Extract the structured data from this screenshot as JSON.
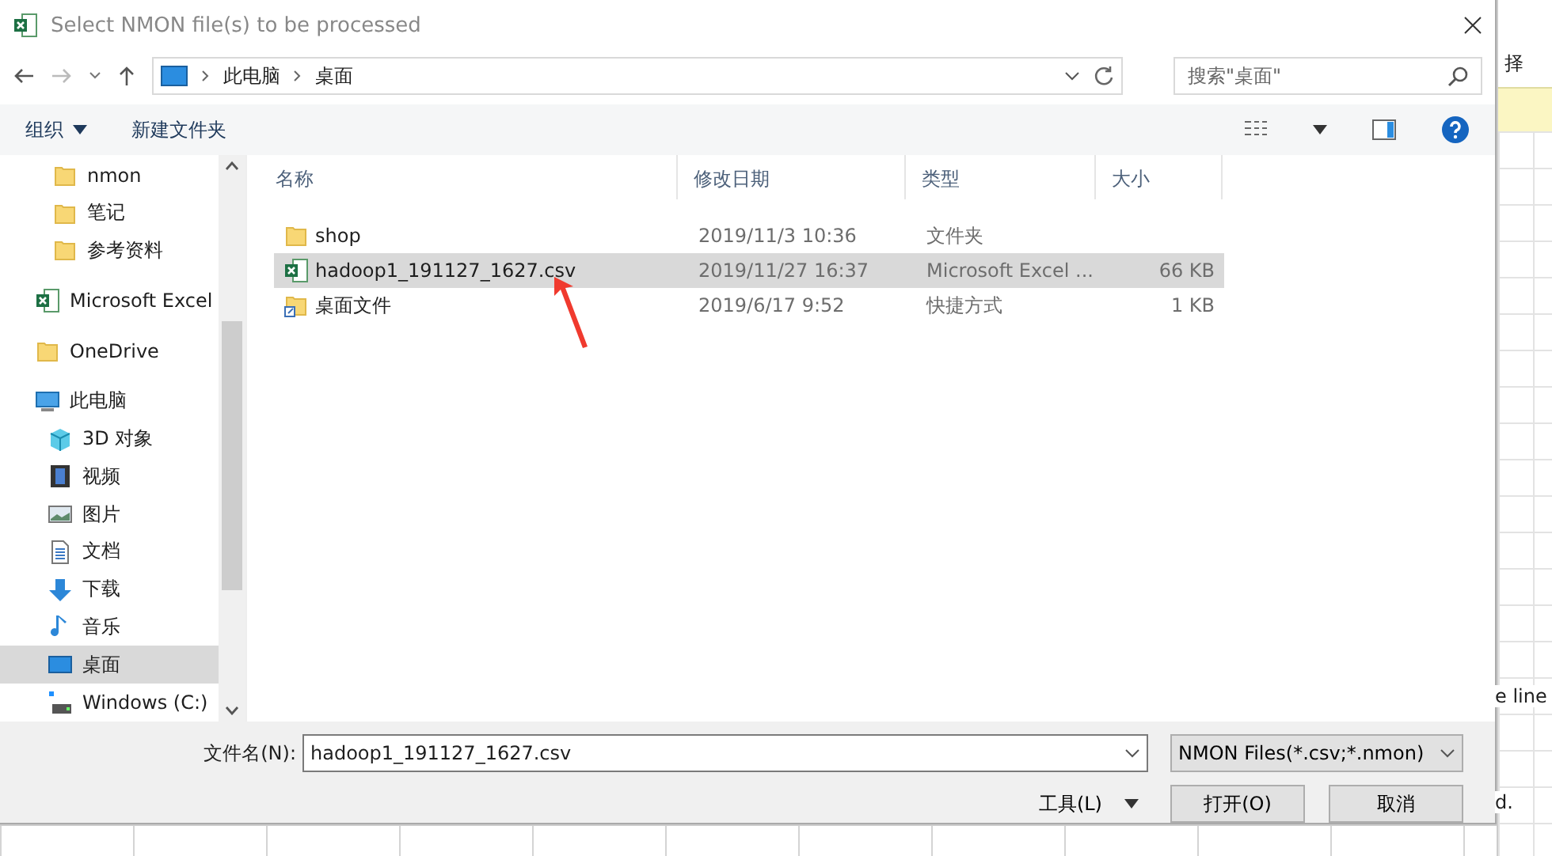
{
  "window": {
    "title": "Select NMON file(s) to be processed"
  },
  "address": {
    "path": [
      "此电脑",
      "桌面"
    ],
    "search_placeholder": "搜索\"桌面\""
  },
  "toolbar": {
    "organize": "组织",
    "new_folder": "新建文件夹"
  },
  "sidebar": {
    "items": [
      {
        "label": "nmon",
        "kind": "folder",
        "indented": true,
        "selected": false
      },
      {
        "label": "笔记",
        "kind": "folder",
        "indented": true,
        "selected": false
      },
      {
        "label": "参考资料",
        "kind": "folder",
        "indented": true,
        "selected": false
      },
      {
        "label": "Microsoft Excel",
        "kind": "excel",
        "indented": false,
        "selected": false
      },
      {
        "label": "OneDrive",
        "kind": "folder",
        "indented": false,
        "selected": false
      },
      {
        "label": "此电脑",
        "kind": "pc",
        "indented": false,
        "selected": false,
        "children": [
          {
            "label": "3D 对象",
            "kind": "cube",
            "selected": false
          },
          {
            "label": "视频",
            "kind": "video",
            "selected": false
          },
          {
            "label": "图片",
            "kind": "image",
            "selected": false
          },
          {
            "label": "文档",
            "kind": "doc",
            "selected": false
          },
          {
            "label": "下载",
            "kind": "download",
            "selected": false
          },
          {
            "label": "音乐",
            "kind": "music",
            "selected": false
          },
          {
            "label": "桌面",
            "kind": "desktop",
            "selected": true
          },
          {
            "label": "Windows (C:)",
            "kind": "drive",
            "selected": false
          }
        ]
      }
    ]
  },
  "table": {
    "columns": [
      "名称",
      "修改日期",
      "类型",
      "大小"
    ],
    "rows": [
      {
        "kind": "folder",
        "name": "shop",
        "date": "2019/11/3 10:36",
        "type": "文件夹",
        "size": "",
        "selected": false
      },
      {
        "kind": "excel",
        "name": "hadoop1_191127_1627.csv",
        "date": "2019/11/27 16:37",
        "type": "Microsoft Excel ...",
        "size": "66 KB",
        "selected": true
      },
      {
        "kind": "shortcut",
        "name": "桌面文件",
        "date": "2019/6/17 9:52",
        "type": "快捷方式",
        "size": "1 KB",
        "selected": false
      }
    ]
  },
  "footer": {
    "filename_label": "文件名(N):",
    "filename": "hadoop1_191127_1627.csv",
    "filter": "NMON Files(*.csv;*.nmon)",
    "tools": "工具(L)",
    "open": "打开(O)",
    "cancel": "取消"
  },
  "background": {
    "fragments": [
      "择",
      "e line",
      "d."
    ]
  }
}
